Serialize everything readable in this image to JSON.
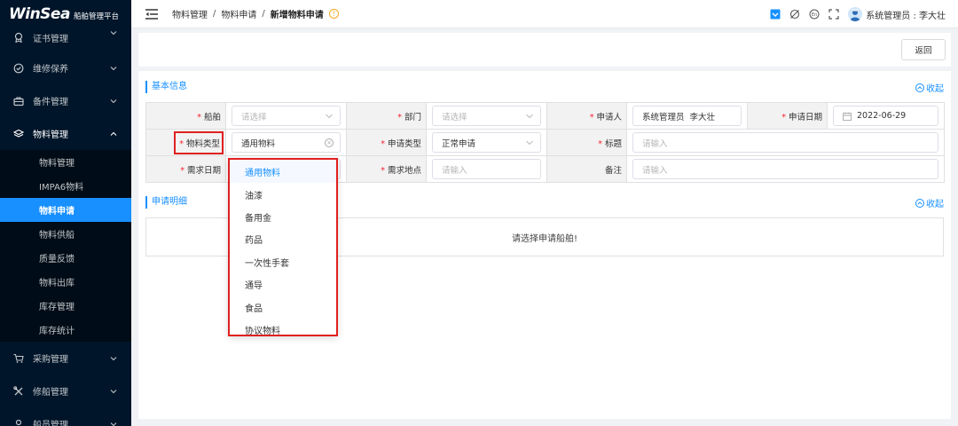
{
  "app": {
    "brand": "WinSea",
    "subtitle": "船舶管理平台"
  },
  "sidebar": {
    "items": [
      {
        "label": "证书管理",
        "icon": "certificate-icon",
        "expanded": false
      },
      {
        "label": "维修保养",
        "icon": "maintenance-icon",
        "expanded": false
      },
      {
        "label": "备件管理",
        "icon": "briefcase-icon",
        "expanded": false
      },
      {
        "label": "物料管理",
        "icon": "layers-icon",
        "expanded": true
      }
    ],
    "submenu": [
      {
        "label": "物料管理",
        "active": false
      },
      {
        "label": "IMPA6物料",
        "active": false
      },
      {
        "label": "物料申请",
        "active": true
      },
      {
        "label": "物料供船",
        "active": false
      },
      {
        "label": "质量反馈",
        "active": false
      },
      {
        "label": "物料出库",
        "active": false
      },
      {
        "label": "库存管理",
        "active": false
      },
      {
        "label": "库存统计",
        "active": false
      }
    ],
    "items_after": [
      {
        "label": "采购管理",
        "icon": "cart-icon"
      },
      {
        "label": "修船管理",
        "icon": "tools-icon"
      },
      {
        "label": "船员管理",
        "icon": "user-icon"
      }
    ]
  },
  "header": {
    "breadcrumb": [
      "物料管理",
      "物料申请",
      "新增物料申请"
    ],
    "user_label": "系统管理员 : 李大壮"
  },
  "toolbar": {
    "back_label": "返回"
  },
  "basic_info": {
    "title": "基本信息",
    "collapse_label": "收起",
    "fields": {
      "ship": {
        "label": "船舶",
        "placeholder": "请选择"
      },
      "department": {
        "label": "部门",
        "placeholder": "请选择"
      },
      "applicant": {
        "label": "申请人",
        "value": "系统管理员  李大壮"
      },
      "apply_date": {
        "label": "申请日期",
        "value": "2022-06-29"
      },
      "material_type": {
        "label": "物料类型",
        "value": "通用物料"
      },
      "apply_type": {
        "label": "申请类型",
        "value": "正常申请"
      },
      "title_field": {
        "label": "标题",
        "placeholder": "请输入"
      },
      "need_date": {
        "label": "需求日期"
      },
      "need_place": {
        "label": "需求地点",
        "placeholder": "请输入"
      },
      "remark": {
        "label": "备注",
        "placeholder": "请输入"
      }
    }
  },
  "detail": {
    "title": "申请明细",
    "collapse_label": "收起",
    "empty_text": "请选择申请船舶!"
  },
  "dropdown": {
    "options": [
      "通用物料",
      "油漆",
      "备用金",
      "药品",
      "一次性手套",
      "通导",
      "食品",
      "协议物料"
    ],
    "selected_index": 0
  },
  "colors": {
    "accent": "#1890ff",
    "sidebar_bg": "#001529",
    "highlight": "#e02020",
    "required": "#f5222d"
  }
}
